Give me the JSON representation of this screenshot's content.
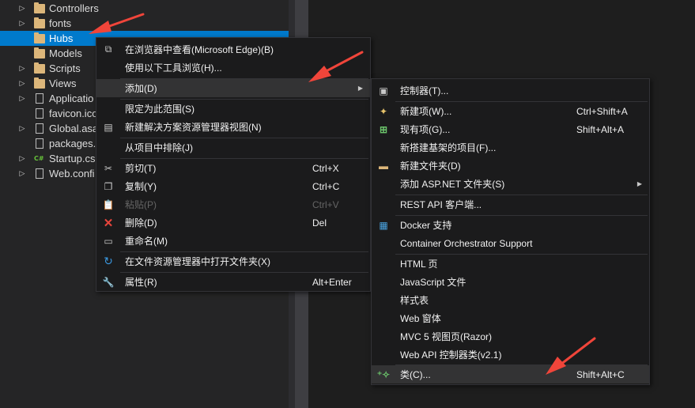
{
  "tree": {
    "items": [
      {
        "label": "Controllers",
        "type": "folder",
        "expandable": true
      },
      {
        "label": "fonts",
        "type": "folder",
        "expandable": true
      },
      {
        "label": "Hubs",
        "type": "folder",
        "expandable": false,
        "selected": true
      },
      {
        "label": "Models",
        "type": "folder",
        "expandable": false
      },
      {
        "label": "Scripts",
        "type": "folder",
        "expandable": true
      },
      {
        "label": "Views",
        "type": "folder",
        "expandable": true
      },
      {
        "label": "Applicatio",
        "type": "config",
        "expandable": true
      },
      {
        "label": "favicon.ico",
        "type": "file",
        "expandable": false
      },
      {
        "label": "Global.asa",
        "type": "config",
        "expandable": true
      },
      {
        "label": "packages.",
        "type": "config",
        "expandable": false
      },
      {
        "label": "Startup.cs",
        "type": "cs",
        "expandable": true
      },
      {
        "label": "Web.confi",
        "type": "config",
        "expandable": true
      }
    ]
  },
  "context_menu": {
    "items": [
      {
        "label": "在浏览器中查看(Microsoft Edge)(B)",
        "icon": "browser-icon",
        "shortcut": ""
      },
      {
        "label": "使用以下工具浏览(H)...",
        "icon": "",
        "shortcut": ""
      },
      {
        "label": "添加(D)",
        "icon": "",
        "shortcut": "",
        "submenu": true,
        "hover": true
      },
      {
        "label": "限定为此范围(S)",
        "icon": "",
        "shortcut": ""
      },
      {
        "label": "新建解决方案资源管理器视图(N)",
        "icon": "new-view-icon",
        "shortcut": ""
      },
      {
        "label": "从项目中排除(J)",
        "icon": "",
        "shortcut": ""
      },
      {
        "label": "剪切(T)",
        "icon": "cut-icon",
        "shortcut": "Ctrl+X"
      },
      {
        "label": "复制(Y)",
        "icon": "copy-icon",
        "shortcut": "Ctrl+C"
      },
      {
        "label": "粘贴(P)",
        "icon": "paste-icon",
        "shortcut": "Ctrl+V",
        "disabled": true
      },
      {
        "label": "删除(D)",
        "icon": "delete-icon",
        "shortcut": "Del"
      },
      {
        "label": "重命名(M)",
        "icon": "rename-icon",
        "shortcut": ""
      },
      {
        "label": "在文件资源管理器中打开文件夹(X)",
        "icon": "refresh-icon",
        "shortcut": ""
      },
      {
        "label": "属性(R)",
        "icon": "wrench-icon",
        "shortcut": "Alt+Enter"
      }
    ]
  },
  "add_submenu": {
    "items": [
      {
        "label": "控制器(T)...",
        "icon": "controller-icon",
        "shortcut": ""
      },
      {
        "label": "新建项(W)...",
        "icon": "new-item-icon",
        "shortcut": "Ctrl+Shift+A"
      },
      {
        "label": "现有项(G)...",
        "icon": "existing-item-icon",
        "shortcut": "Shift+Alt+A"
      },
      {
        "label": "新搭建基架的项目(F)...",
        "icon": "",
        "shortcut": ""
      },
      {
        "label": "新建文件夹(D)",
        "icon": "new-folder-icon",
        "shortcut": ""
      },
      {
        "label": "添加 ASP.NET 文件夹(S)",
        "icon": "",
        "shortcut": "",
        "submenu": true
      },
      {
        "label": "REST API 客户端...",
        "icon": "",
        "shortcut": ""
      },
      {
        "label": "Docker 支持",
        "icon": "docker-icon",
        "shortcut": ""
      },
      {
        "label": "Container Orchestrator Support",
        "icon": "",
        "shortcut": ""
      },
      {
        "label": "HTML 页",
        "icon": "",
        "shortcut": ""
      },
      {
        "label": "JavaScript 文件",
        "icon": "",
        "shortcut": ""
      },
      {
        "label": "样式表",
        "icon": "",
        "shortcut": ""
      },
      {
        "label": "Web 窗体",
        "icon": "",
        "shortcut": ""
      },
      {
        "label": "MVC 5 视图页(Razor)",
        "icon": "",
        "shortcut": ""
      },
      {
        "label": "Web API 控制器类(v2.1)",
        "icon": "",
        "shortcut": ""
      },
      {
        "label": "类(C)...",
        "icon": "class-icon",
        "shortcut": "Shift+Alt+C",
        "hover": true
      }
    ]
  },
  "colors": {
    "selection": "#007acc",
    "menu_bg": "#1b1b1c",
    "menu_hover": "#333334",
    "arrow": "#f0453a"
  }
}
